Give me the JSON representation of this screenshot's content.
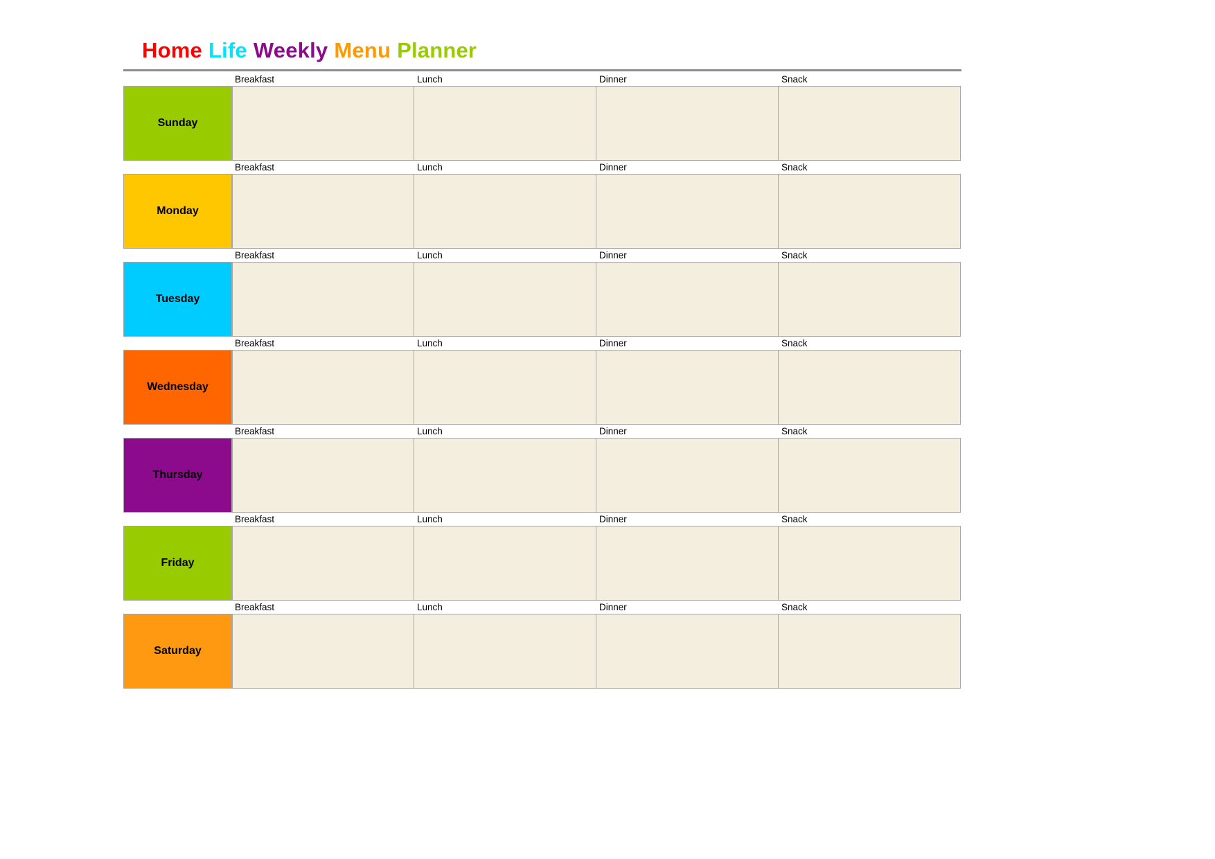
{
  "title": {
    "words": [
      {
        "text": "Home",
        "color": "#FF0000"
      },
      {
        "text": "Life",
        "color": "#00E5FF"
      },
      {
        "text": "Weekly",
        "color": "#8C0B8C"
      },
      {
        "text": "Menu",
        "color": "#FF9900"
      },
      {
        "text": "Planner",
        "color": "#99CC00"
      }
    ],
    "full_text": "Home Life Weekly Menu Planner"
  },
  "meal_columns": [
    "Breakfast",
    "Lunch",
    "Dinner",
    "Snack"
  ],
  "cell_background": "#F3EEDE",
  "border_color": "#A6A6A6",
  "rule_color": "#8C8C8C",
  "days": [
    {
      "name": "Sunday",
      "color": "#99CC00",
      "meals": {
        "Breakfast": "",
        "Lunch": "",
        "Dinner": "",
        "Snack": ""
      }
    },
    {
      "name": "Monday",
      "color": "#FFC700",
      "meals": {
        "Breakfast": "",
        "Lunch": "",
        "Dinner": "",
        "Snack": ""
      }
    },
    {
      "name": "Tuesday",
      "color": "#00CCFF",
      "meals": {
        "Breakfast": "",
        "Lunch": "",
        "Dinner": "",
        "Snack": ""
      }
    },
    {
      "name": "Wednesday",
      "color": "#FF6600",
      "meals": {
        "Breakfast": "",
        "Lunch": "",
        "Dinner": "",
        "Snack": ""
      }
    },
    {
      "name": "Thursday",
      "color": "#8C0B8C",
      "meals": {
        "Breakfast": "",
        "Lunch": "",
        "Dinner": "",
        "Snack": ""
      }
    },
    {
      "name": "Friday",
      "color": "#99CC00",
      "meals": {
        "Breakfast": "",
        "Lunch": "",
        "Dinner": "",
        "Snack": ""
      }
    },
    {
      "name": "Saturday",
      "color": "#FF9911",
      "meals": {
        "Breakfast": "",
        "Lunch": "",
        "Dinner": "",
        "Snack": ""
      }
    }
  ]
}
